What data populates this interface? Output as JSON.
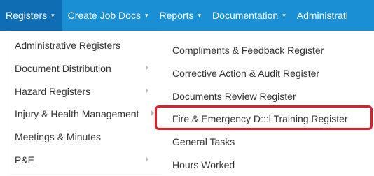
{
  "navbar": {
    "items": [
      {
        "label": "Registers",
        "active": true
      },
      {
        "label": "Create Job Docs"
      },
      {
        "label": "Reports"
      },
      {
        "label": "Documentation"
      },
      {
        "label": "Administrati"
      }
    ],
    "caret": "▾",
    "colors": {
      "bar": "#1a8fd3",
      "active": "#0f6db3"
    }
  },
  "dropdown": {
    "items": [
      {
        "label": "Administrative Registers"
      },
      {
        "label": "Document Distribution",
        "has_submenu": true
      },
      {
        "label": "Hazard Registers",
        "has_submenu": true
      },
      {
        "label": "Injury & Health Management",
        "has_submenu": true
      },
      {
        "label": "Meetings & Minutes"
      },
      {
        "label": "P&E",
        "has_submenu": true
      }
    ]
  },
  "submenu": {
    "items": [
      {
        "label": "Compliments & Feedback Register"
      },
      {
        "label": "Corrective Action & Audit Register"
      },
      {
        "label": "Documents Review Register"
      },
      {
        "label": "Fire & Emergency D:::l Training Register",
        "highlighted": true
      },
      {
        "label": "General Tasks"
      },
      {
        "label": "Hours Worked"
      }
    ]
  },
  "highlight": {
    "color": "#e21d2b"
  }
}
